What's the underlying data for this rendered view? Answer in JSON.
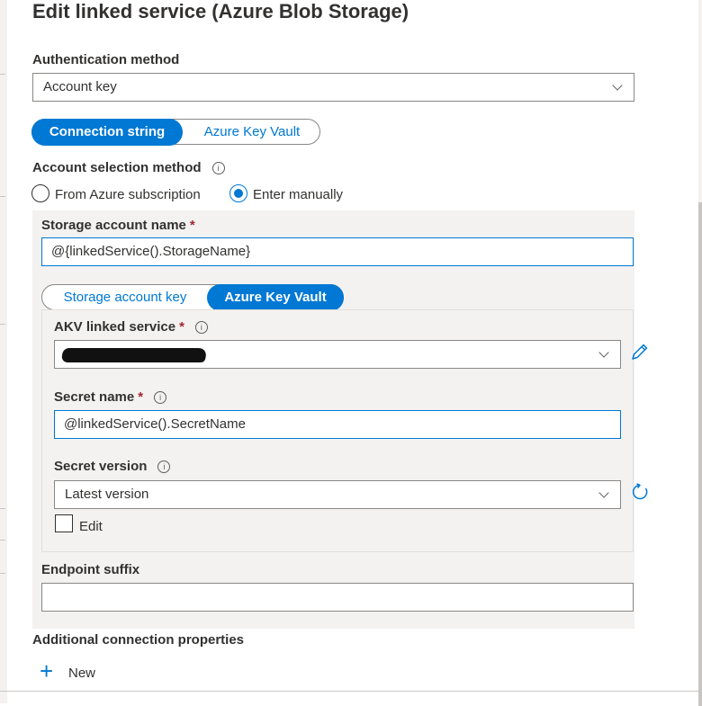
{
  "title": "Edit linked service (Azure Blob Storage)",
  "auth": {
    "label": "Authentication method",
    "value": "Account key"
  },
  "connection_toggle": {
    "active": "Connection string",
    "inactive": "Azure Key Vault"
  },
  "account_selection": {
    "label": "Account selection method",
    "info": "i",
    "options": [
      "From Azure subscription",
      "Enter manually"
    ],
    "selected": "Enter manually"
  },
  "storage_account": {
    "label": "Storage account name",
    "required": "*",
    "value": "@{linkedService().StorageName}"
  },
  "key_toggle": {
    "inactive": "Storage account key",
    "active": "Azure Key Vault"
  },
  "akv": {
    "label": "AKV linked service",
    "required": "*",
    "info": "i"
  },
  "secret_name": {
    "label": "Secret name",
    "required": "*",
    "info": "i",
    "value": "@linkedService().SecretName"
  },
  "secret_version": {
    "label": "Secret version",
    "info": "i",
    "value": "Latest version",
    "edit_label": "Edit"
  },
  "endpoint": {
    "label": "Endpoint suffix",
    "value": ""
  },
  "additional": {
    "label": "Additional connection properties",
    "plus": "+",
    "new_label": "New"
  },
  "colors": {
    "accent": "#0078d4",
    "panel": "#f3f2f1",
    "required": "#a4262c"
  },
  "icons": [
    "info-icon",
    "chevron-down-icon",
    "edit-pencil-icon",
    "refresh-icon",
    "plus-icon"
  ]
}
